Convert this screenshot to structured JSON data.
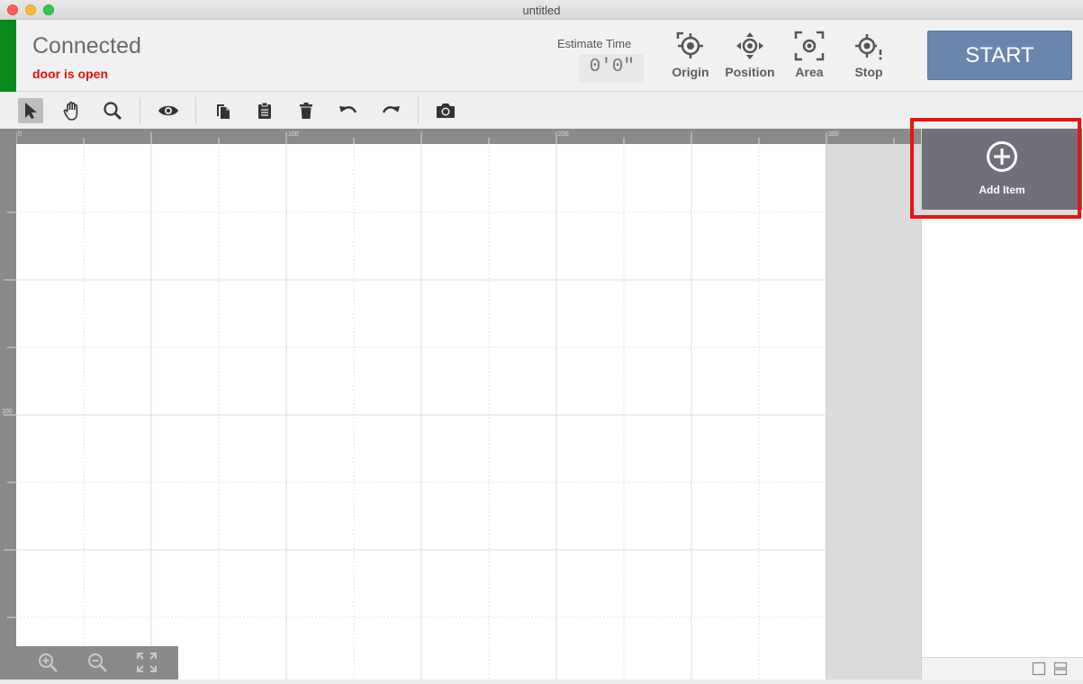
{
  "window": {
    "title": "untitled"
  },
  "status": {
    "title": "Connected",
    "subtitle": "door is open",
    "indicator_color": "#0a8a1c",
    "subtitle_color": "#e0140f"
  },
  "estimate": {
    "label": "Estimate Time",
    "value": "0'0\""
  },
  "tools": [
    {
      "label": "Origin",
      "icon": "origin-icon"
    },
    {
      "label": "Position",
      "icon": "position-icon"
    },
    {
      "label": "Area",
      "icon": "area-icon"
    },
    {
      "label": "Stop",
      "icon": "stop-icon"
    }
  ],
  "start_button": {
    "label": "START",
    "color": "#6a86ad"
  },
  "toolbar": [
    "select-pointer-icon",
    "hand-pan-icon",
    "magnifier-icon",
    "eye-preview-icon",
    "copy-icon",
    "paste-clipboard-icon",
    "trash-icon",
    "undo-icon",
    "redo-icon",
    "camera-icon"
  ],
  "ruler": {
    "top_ticks": [
      "0",
      "100",
      "200",
      "300"
    ],
    "left_ticks": [
      "100"
    ]
  },
  "panel": {
    "add_item_label": "Add Item"
  }
}
